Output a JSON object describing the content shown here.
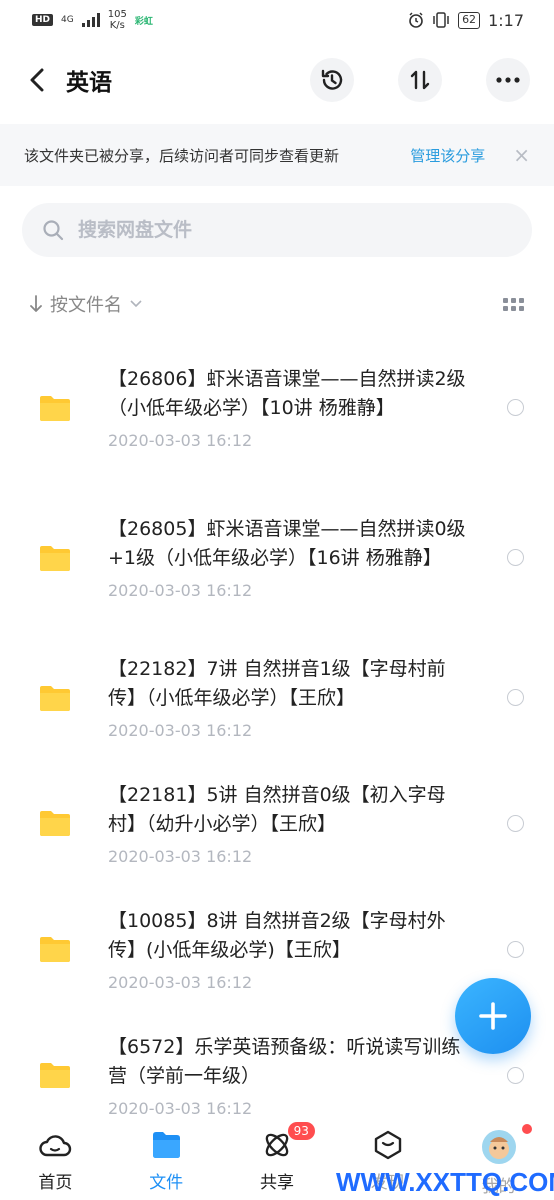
{
  "status_bar": {
    "hd": "HD",
    "network": "4G",
    "speed_value": "105",
    "speed_unit": "K/s",
    "app_badge": "彩虹",
    "battery": "62",
    "time": "1:17"
  },
  "header": {
    "title": "英语"
  },
  "banner": {
    "text": "该文件夹已被分享，后续访问者可同步查看更新",
    "link": "管理该分享",
    "close": "×"
  },
  "search": {
    "placeholder": "搜索网盘文件"
  },
  "sort": {
    "label": "按文件名"
  },
  "files": [
    {
      "name": "【26806】虾米语音课堂——自然拼读2级（小低年级必学）【10讲 杨雅静】",
      "date": "2020-03-03  16:12"
    },
    {
      "name": "【26805】虾米语音课堂——自然拼读0级+1级（小低年级必学）【16讲 杨雅静】",
      "date": "2020-03-03  16:12"
    },
    {
      "name": "【22182】7讲 自然拼音1级【字母村前传】（小低年级必学）【王欣】",
      "date": "2020-03-03  16:12"
    },
    {
      "name": "【22181】5讲 自然拼音0级【初入字母村】（幼升小必学）【王欣】",
      "date": "2020-03-03  16:12"
    },
    {
      "name": "【10085】8讲 自然拼音2级【字母村外传】(小低年级必学)【王欣】",
      "date": "2020-03-03  16:12"
    },
    {
      "name": "【6572】乐学英语预备级：听说读写训练营（学前一年级）",
      "date": "2020-03-03  16:12"
    }
  ],
  "bottom_nav": {
    "items": [
      {
        "label": "首页",
        "icon": "home-cloud-icon"
      },
      {
        "label": "文件",
        "icon": "folder-icon"
      },
      {
        "label": "共享",
        "icon": "share-atom-icon",
        "badge": "93"
      },
      {
        "label": "发现",
        "icon": "discover-icon"
      },
      {
        "label": "我的",
        "icon": "avatar"
      }
    ]
  },
  "watermark": "WWW.XXTTQ.COM",
  "colors": {
    "accent": "#1e90f5",
    "folder": "#ffc933",
    "badge": "#ff4d4f",
    "link": "#2a9cde"
  }
}
